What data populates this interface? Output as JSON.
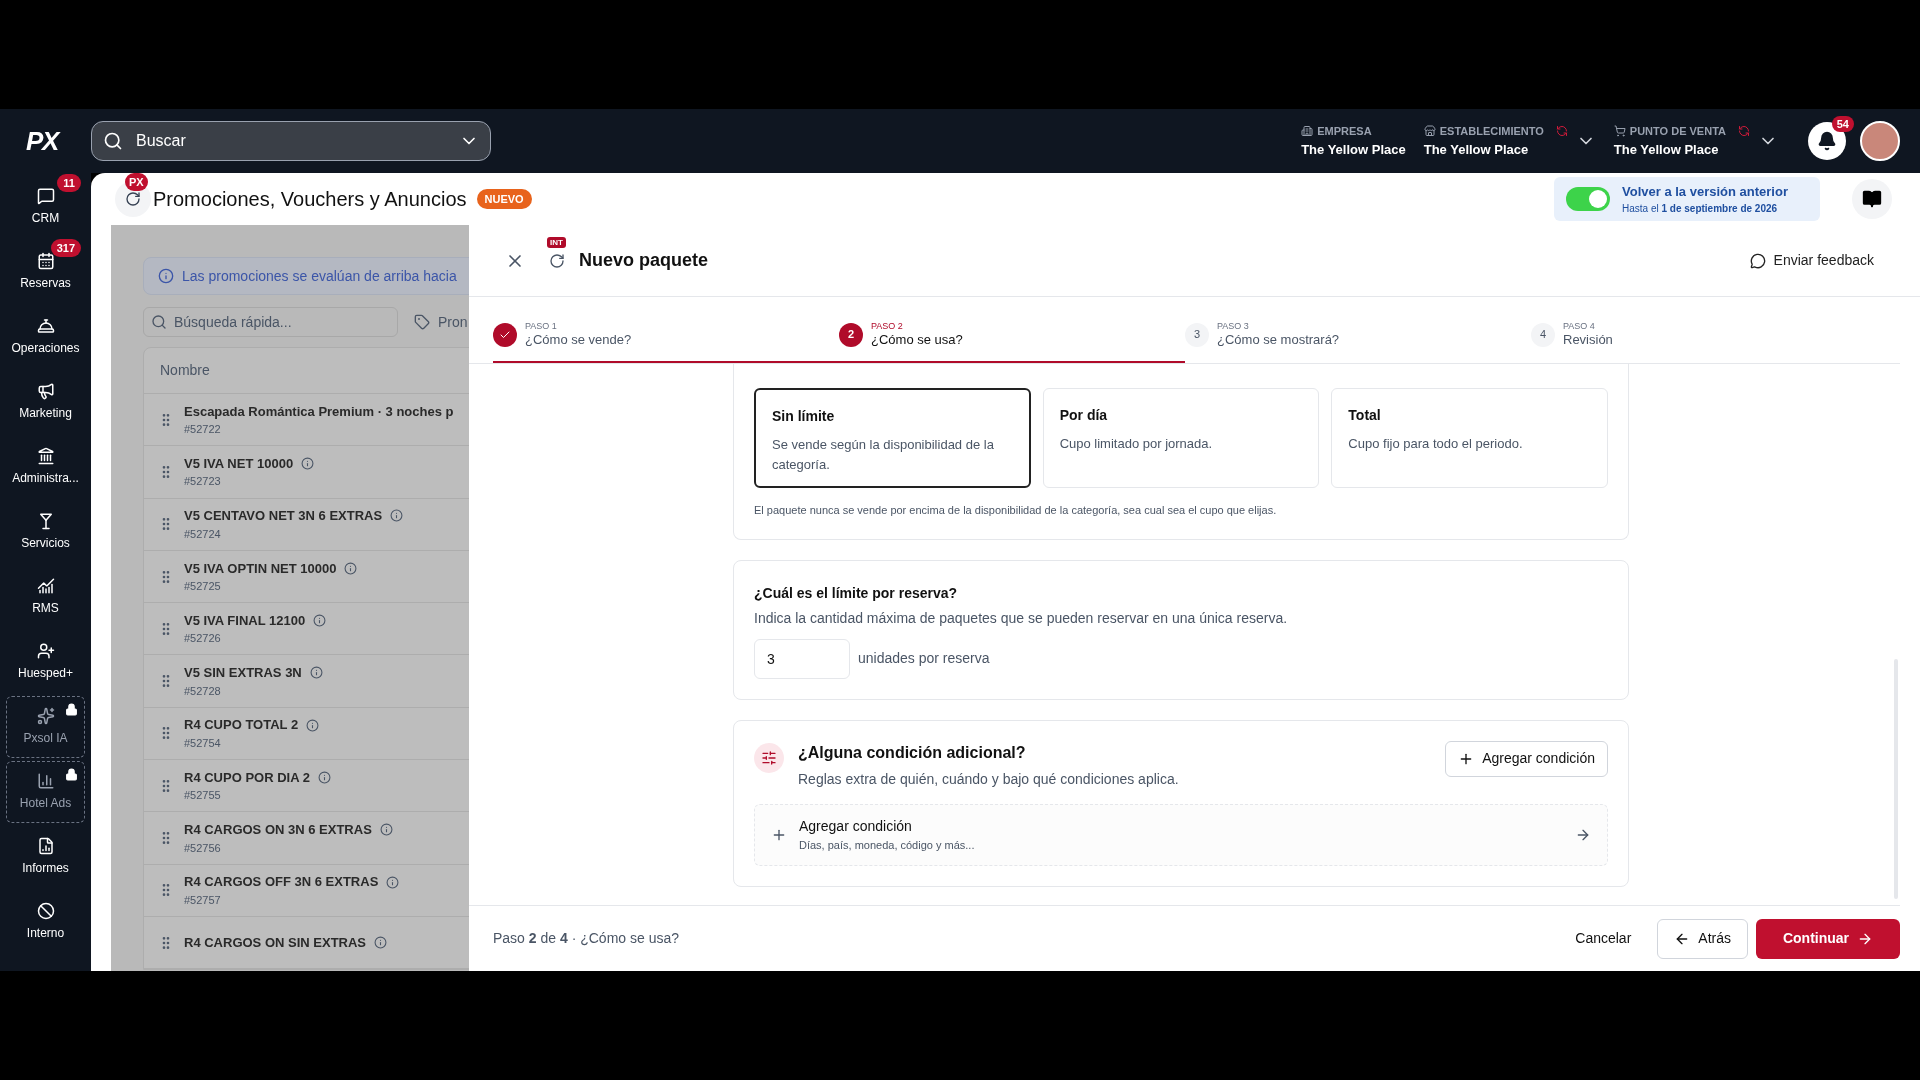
{
  "topbar": {
    "search": {
      "placeholder": "Buscar"
    },
    "contexts": [
      {
        "label": "EMPRESA",
        "value": "The Yellow Place",
        "alert": false,
        "dropdown": false
      },
      {
        "label": "ESTABLECIMIENTO",
        "value": "The Yellow Place",
        "alert": true,
        "dropdown": true
      },
      {
        "label": "PUNTO DE VENTA",
        "value": "The Yellow Place",
        "alert": true,
        "dropdown": true
      }
    ],
    "notifications": "54"
  },
  "sidebar": {
    "logo": "PX",
    "items": [
      {
        "kind": "chat",
        "label": "CRM",
        "badge": "11",
        "locked": false
      },
      {
        "kind": "calendar",
        "label": "Reservas",
        "badge": "317",
        "locked": false
      },
      {
        "kind": "bell",
        "label": "Operaciones",
        "locked": false
      },
      {
        "kind": "megaphone",
        "label": "Marketing",
        "locked": false
      },
      {
        "kind": "bank",
        "label": "Administra...",
        "locked": false
      },
      {
        "kind": "glass",
        "label": "Servicios",
        "locked": false
      },
      {
        "kind": "chart",
        "label": "RMS",
        "locked": false
      },
      {
        "kind": "guest",
        "label": "Huesped+",
        "locked": false
      },
      {
        "kind": "sparkle",
        "label": "Pxsol IA",
        "locked": true
      },
      {
        "kind": "bars",
        "label": "Hotel Ads",
        "locked": true
      },
      {
        "kind": "report",
        "label": "Informes",
        "locked": false
      },
      {
        "kind": "ban",
        "label": "Interno",
        "locked": false
      }
    ]
  },
  "page": {
    "badge": "PX",
    "title": "Promociones, Vouchers y Anuncios",
    "tag": "NUEVO",
    "legacy": {
      "on": true,
      "title": "Volver a la versión anterior",
      "note": "Hasta el **1 de septiembre de 2026**"
    }
  },
  "list": {
    "info": "Las promociones se evalúan de arriba hacia",
    "search": {
      "placeholder": "Búsqueda rápida..."
    },
    "filter": "Pron",
    "column": "Nombre",
    "rows": [
      {
        "name": "Escapada Romántica Premium · 3 noches p",
        "id": "#52722",
        "info": false
      },
      {
        "name": "V5 IVA NET 10000",
        "id": "#52723",
        "info": true
      },
      {
        "name": "V5 CENTAVO NET 3N 6 EXTRAS",
        "id": "#52724",
        "info": true
      },
      {
        "name": "V5 IVA OPTIN NET 10000",
        "id": "#52725",
        "info": true
      },
      {
        "name": "V5 IVA FINAL 12100",
        "id": "#52726",
        "info": true
      },
      {
        "name": "V5 SIN EXTRAS 3N",
        "id": "#52728",
        "info": true
      },
      {
        "name": "R4 CUPO TOTAL 2",
        "id": "#52754",
        "info": true
      },
      {
        "name": "R4 CUPO POR DIA 2",
        "id": "#52755",
        "info": true
      },
      {
        "name": "R4 CARGOS ON 3N 6 EXTRAS",
        "id": "#52756",
        "info": true
      },
      {
        "name": "R4 CARGOS OFF 3N 6 EXTRAS",
        "id": "#52757",
        "info": true
      },
      {
        "name": "R4 CARGOS ON SIN EXTRAS",
        "info": true
      }
    ]
  },
  "modal": {
    "badge": "INT",
    "title": "Nuevo paquete",
    "feedback": "Enviar feedback",
    "steps": [
      {
        "caption": "PASO 1",
        "label": "¿Cómo se vende?",
        "done": true,
        "selected": false
      },
      {
        "number": "2",
        "caption": "PASO 2",
        "label": "¿Cómo se usa?",
        "done": false,
        "selected": true
      },
      {
        "number": "3",
        "caption": "PASO 3",
        "label": "¿Cómo se mostrará?",
        "done": false,
        "selected": false
      },
      {
        "number": "4",
        "caption": "PASO 4",
        "label": "Revisión",
        "done": false,
        "selected": false
      }
    ],
    "quota": {
      "options": [
        {
          "title": "Sin límite",
          "text": "Se vende según la disponibilidad de la categoría.",
          "selected": true
        },
        {
          "title": "Por día",
          "text": "Cupo limitado por jornada.",
          "selected": false
        },
        {
          "title": "Total",
          "text": "Cupo fijo para todo el periodo.",
          "selected": false
        }
      ],
      "note": "El paquete nunca se vende por encima de la disponibilidad de la categoría, sea cual sea el cupo que elijas."
    },
    "limit": {
      "title": "¿Cuál es el límite por reserva?",
      "text": "Indica la cantidad máxima de paquetes que se pueden reservar en una única reserva.",
      "value": "3",
      "unit": "unidades por reserva"
    },
    "conditions": {
      "title": "¿Alguna condición adicional?",
      "text": "Reglas extra de quién, cuándo y bajo qué condiciones aplica.",
      "button": "Agregar condición",
      "row_title": "Agregar condición",
      "row_text": "Días, país, moneda, código y más..."
    },
    "footer": {
      "progress": "Paso **2** de **4** · ¿Cómo se usa?",
      "cancel": "Cancelar",
      "back": "Atrás",
      "next": "Continuar"
    }
  }
}
